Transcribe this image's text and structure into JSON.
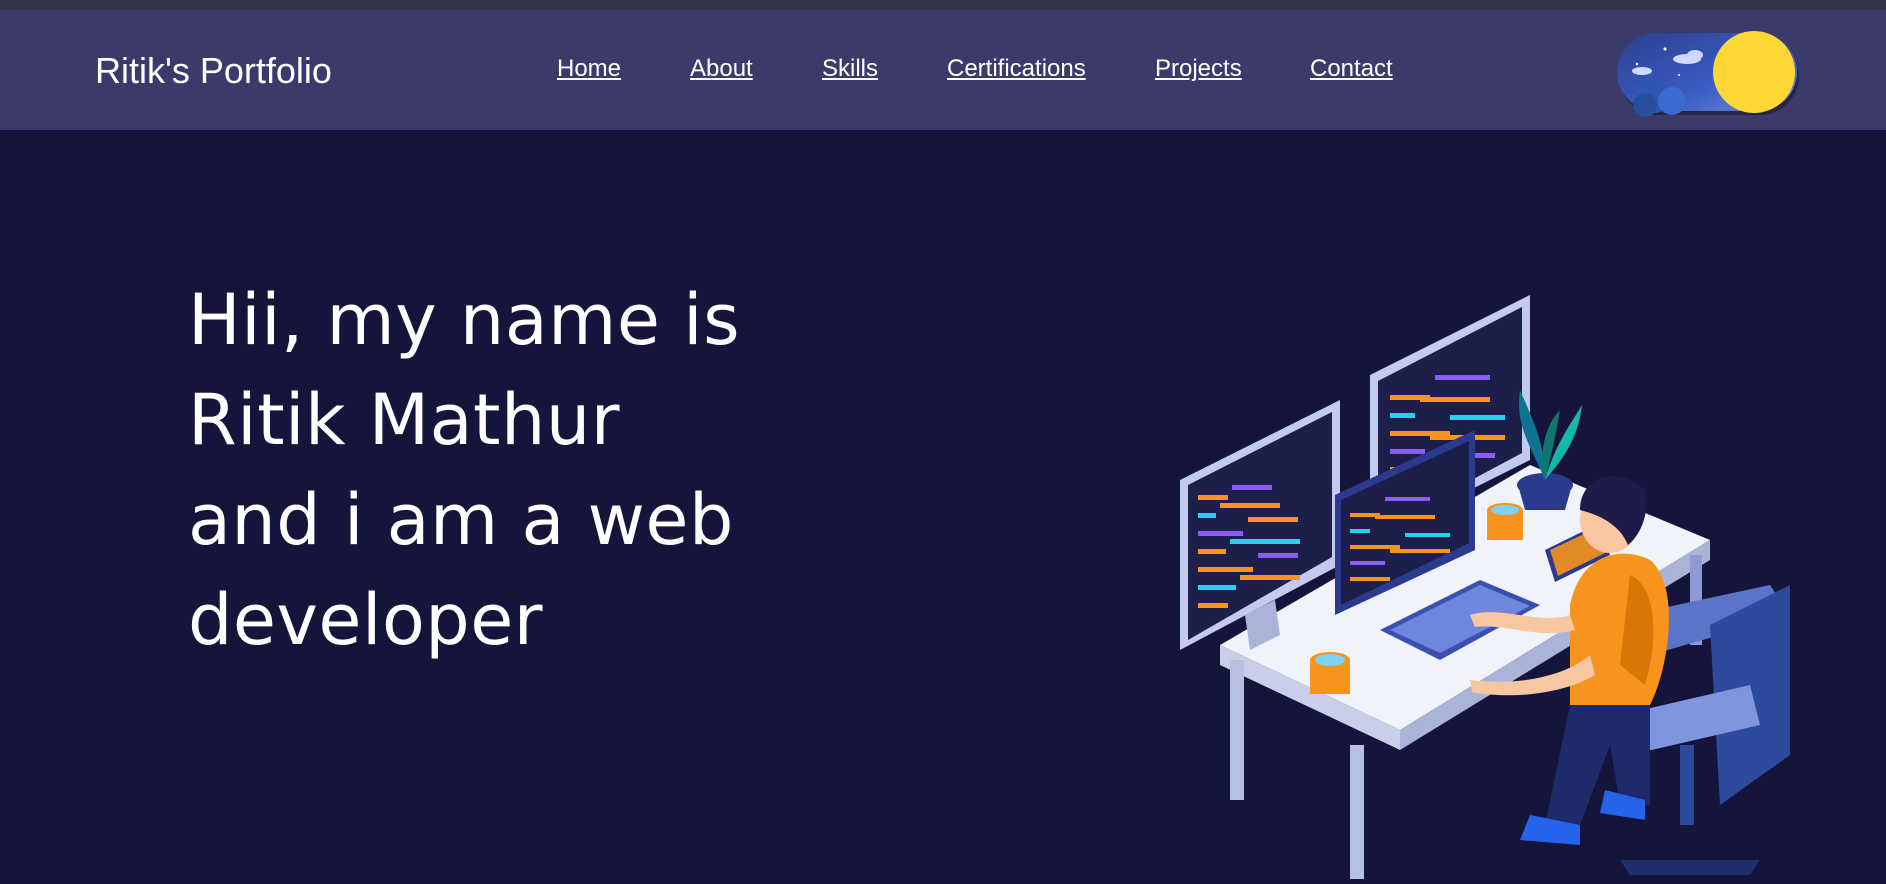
{
  "navbar": {
    "brand": "Ritik's Portfolio",
    "links": [
      {
        "label": "Home"
      },
      {
        "label": "About"
      },
      {
        "label": "Skills"
      },
      {
        "label": "Certifications"
      },
      {
        "label": "Projects"
      },
      {
        "label": "Contact"
      }
    ],
    "theme_toggle": {
      "icon": "sun-moon-toggle-icon",
      "state": "day"
    }
  },
  "hero": {
    "lines": [
      "Hii, my name is",
      "Ritik Mathur",
      "and i am a web",
      "developer"
    ],
    "illustration": "developer-at-desk-illustration"
  },
  "colors": {
    "navbar_bg": "#3c3a6b",
    "page_bg": "#15143a",
    "text": "#ffffff",
    "sun": "#fdd835",
    "accent_orange": "#f7941d"
  }
}
